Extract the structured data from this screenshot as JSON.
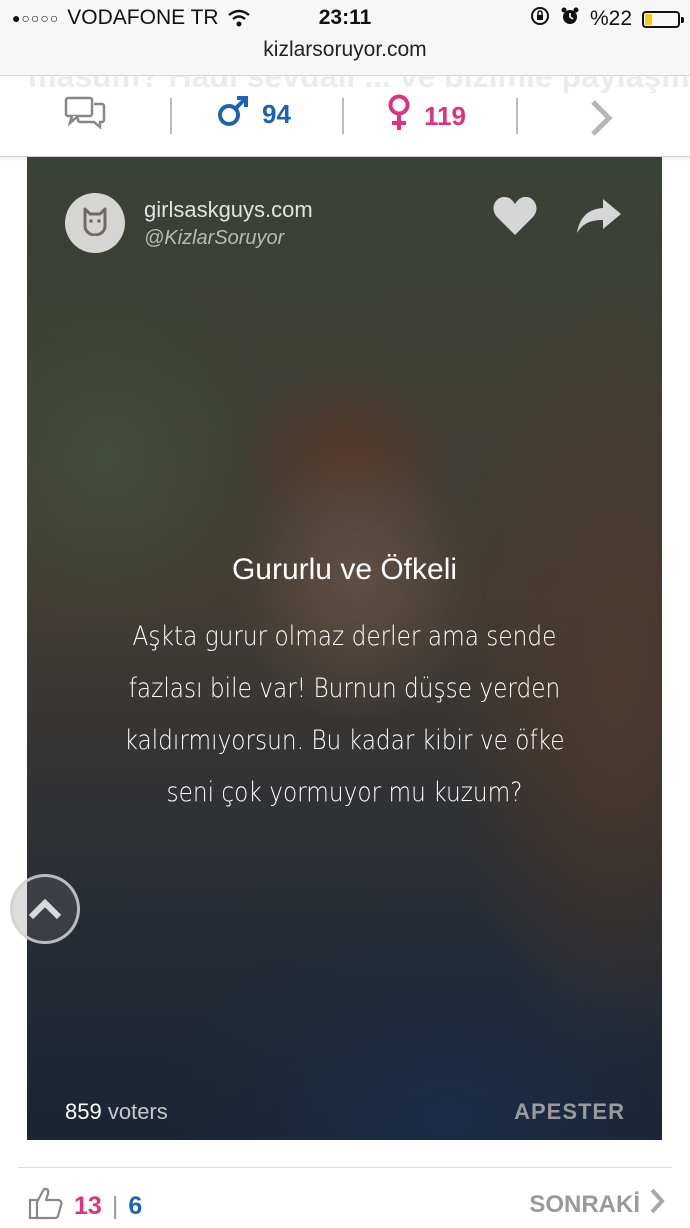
{
  "status_bar": {
    "signal": "●○○○○",
    "carrier": "VODAFONE TR",
    "time": "23:11",
    "battery": "%22",
    "battery_level": 0.22,
    "battery_color": "#f6c915"
  },
  "browser": {
    "url": "kizlarsoruyor.com"
  },
  "header": {
    "background_text": "masum? Hadi sevdalı ... ve bizimle paylaşmayı ... tmi? K...",
    "male_count": "94",
    "female_count": "119",
    "icons": [
      "comments-icon",
      "male-icon",
      "female-icon",
      "chevron-right-icon"
    ],
    "male_color": "#1b63b5",
    "female_color": "#e0317f"
  },
  "quiz_card": {
    "brand": "girlsaskguys.com",
    "handle": "@KizlarSoruyor",
    "result_title": "Gururlu ve Öfkeli",
    "result_description": "Aşkta gurur olmaz derler ama sende fazlası bile var! Burnun düşse yerden kaldırmıyorsun. Bu kadar kibir ve öfke seni çok yormuyor mu kuzum?",
    "voter_count": "859",
    "voters_label": "voters",
    "provider": "APESTER"
  },
  "footer": {
    "like_count": "13",
    "separator": "|",
    "dislike_count": "6",
    "next_label": "SONRAKİ"
  }
}
